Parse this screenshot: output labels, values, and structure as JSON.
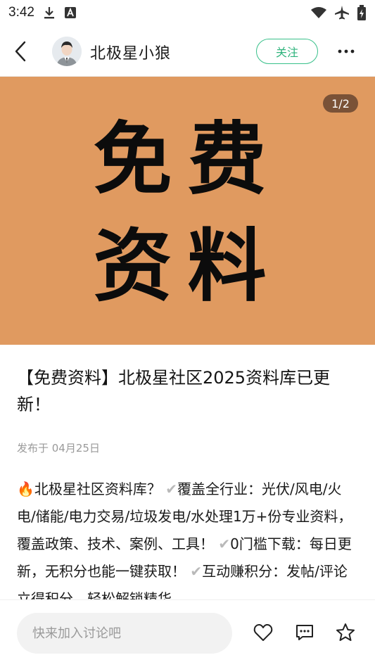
{
  "status_bar": {
    "time": "3:42",
    "left_icons": [
      "download-icon",
      "text-a-icon"
    ],
    "right_icons": [
      "wifi-icon",
      "airplane-icon",
      "battery-icon"
    ]
  },
  "header": {
    "author_name": "北极星小狼",
    "follow_label": "关注",
    "accent_color": "#38c08a"
  },
  "banner": {
    "line1": "免费",
    "line2": "资料",
    "background_color": "#e09a60",
    "page_indicator": "1/2"
  },
  "post": {
    "title": "【免费资料】北极星社区2025资料库已更新！",
    "date": "发布于 04月25日",
    "body": {
      "fire": "🔥",
      "seg1": "北极星社区资料库？",
      "check1": "✔",
      "seg2": "覆盖全行业：光伏/风电/火电/储能/电力交易/垃圾发电/水处理1万+份专业资料，覆盖政策、技术、案例、工具！",
      "check2": "✔",
      "seg3": "0门槛下载：每日更新，无积分也能一键获取！",
      "check3": "✔",
      "seg4": "互动赚积分：发帖/评论立得积分，轻松解锁精华"
    }
  },
  "bottom_bar": {
    "comment_placeholder": "快来加入讨论吧",
    "actions": [
      "heart-icon",
      "comment-icon",
      "star-icon"
    ]
  }
}
